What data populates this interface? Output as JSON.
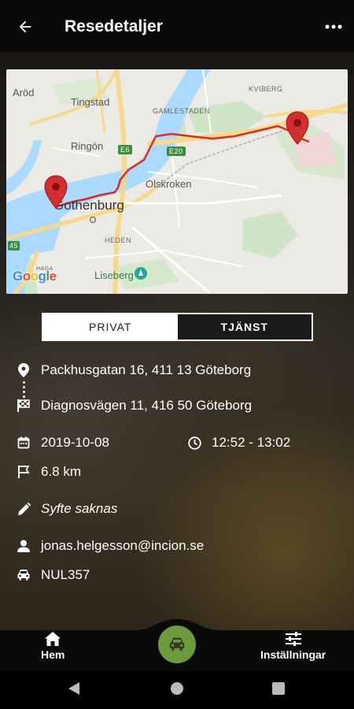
{
  "app_bar": {
    "title": "Resedetaljer",
    "back_icon": "arrow-left-icon",
    "more_icon": "more-vertical-icon"
  },
  "map": {
    "labels": {
      "arod": "Aröd",
      "tingstad": "Tingstad",
      "gamlestaden": "GAMLESTADEN",
      "kviberg": "KVIBERG",
      "ringon": "Ringön",
      "e6": "E6",
      "e20": "E20",
      "olskroken": "Olskroken",
      "gothenburg": "Gothenburg",
      "heden": "HEDEN",
      "liseberg": "Liseberg",
      "road45": "45",
      "haga": "HAGA",
      "google": "Google"
    },
    "route_color": "#e02a1b"
  },
  "trip_type": {
    "private_label": "PRIVAT",
    "work_label": "TJÄNST",
    "selected": "PRIVAT"
  },
  "trip": {
    "start_address": "Packhusgatan 16, 411 13 Göteborg",
    "end_address": "Diagnosvägen 11, 416 50 Göteborg",
    "date": "2019-10-08",
    "time": "12:52 - 13:02",
    "distance": "6.8 km",
    "purpose": "Syfte saknas",
    "user": "jonas.helgesson@incion.se",
    "vehicle": "NUL357"
  },
  "bottom_nav": {
    "home_label": "Hem",
    "settings_label": "Inställningar",
    "fab_icon": "car-icon"
  },
  "colors": {
    "accent": "#6d9a3c",
    "app_bar": "#0a0a0a",
    "pin": "#d32f2f"
  }
}
